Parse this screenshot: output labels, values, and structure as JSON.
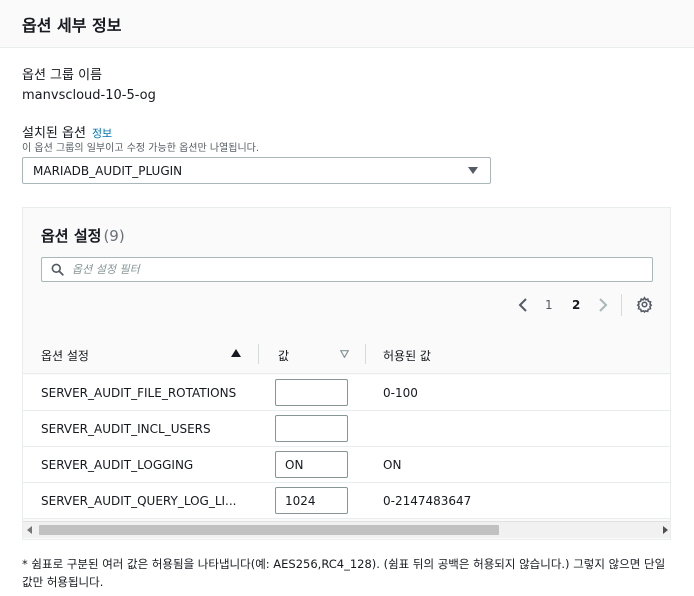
{
  "header": {
    "title": "옵션 세부 정보"
  },
  "option_group": {
    "label": "옵션 그룹 이름",
    "value": "manvscloud-10-5-og"
  },
  "installed_option": {
    "label": "설치된 옵션",
    "info_link": "정보",
    "hint": "이 옵션 그룹의 일부이고 수정 가능한 옵션만 나열됩니다.",
    "selected": "MARIADB_AUDIT_PLUGIN"
  },
  "settings_panel": {
    "title": "옵션 설정",
    "count": "(9)",
    "filter_placeholder": "옵션 설정 필터",
    "pagination": {
      "pages": [
        "1",
        "2"
      ],
      "current": "2"
    },
    "columns": {
      "name": "옵션 설정",
      "value": "값",
      "allowed": "허용된 값"
    },
    "rows": [
      {
        "name": "SERVER_AUDIT_FILE_ROTATIONS",
        "value": "",
        "allowed": "0-100"
      },
      {
        "name": "SERVER_AUDIT_INCL_USERS",
        "value": "",
        "allowed": ""
      },
      {
        "name": "SERVER_AUDIT_LOGGING",
        "value": "ON",
        "allowed": "ON"
      },
      {
        "name": "SERVER_AUDIT_QUERY_LOG_LI...",
        "value": "1024",
        "allowed": "0-2147483647"
      }
    ]
  },
  "icons": {
    "search": "search-icon",
    "prev": "chevron-left-icon",
    "next": "chevron-right-icon",
    "settings": "gear-icon",
    "dropdown": "caret-down-icon",
    "sort_asc": "sort-ascending-icon",
    "sort_desc": "sort-descending-icon"
  },
  "colors": {
    "link": "#0073bb",
    "text": "#16191f",
    "border": "#aab7b8"
  },
  "footnote": "* 쉼표로 구분된 여러 값은 허용됨을 나타냅니다(예: AES256,RC4_128). (쉼표 뒤의 공백은 허용되지 않습니다.) 그렇지 않으면 단일 값만 허용됩니다."
}
